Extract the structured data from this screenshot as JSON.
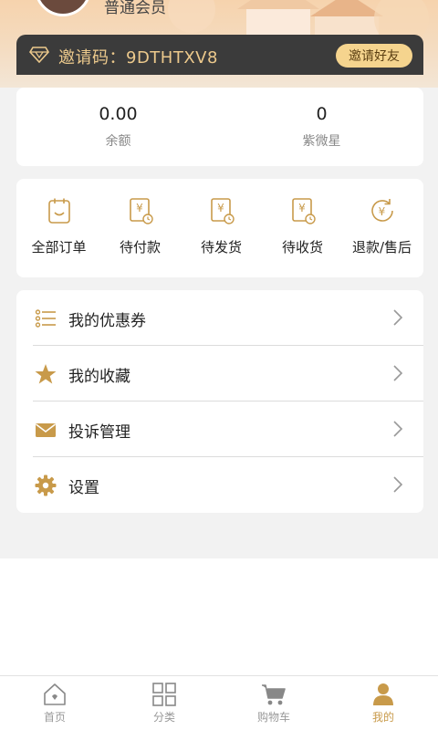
{
  "header": {
    "member_level": "普通会员",
    "invite_code_text": "邀请码：9DTHTXV8",
    "invite_button": "邀请好友"
  },
  "stats": [
    {
      "value": "0.00",
      "label": "余额"
    },
    {
      "value": "0",
      "label": "紫微星"
    }
  ],
  "orders": [
    {
      "label": "全部订单",
      "icon": "order-list-icon"
    },
    {
      "label": "待付款",
      "icon": "pending-payment-icon"
    },
    {
      "label": "待发货",
      "icon": "pending-shipment-icon"
    },
    {
      "label": "待收货",
      "icon": "pending-receipt-icon"
    },
    {
      "label": "退款/售后",
      "icon": "refund-icon"
    }
  ],
  "menu": [
    {
      "label": "我的优惠券",
      "icon": "coupon-list-icon"
    },
    {
      "label": "我的收藏",
      "icon": "star-icon"
    },
    {
      "label": "投诉管理",
      "icon": "envelope-icon"
    },
    {
      "label": "设置",
      "icon": "gear-icon"
    }
  ],
  "tabbar": [
    {
      "label": "首页",
      "icon": "home-icon",
      "active": false
    },
    {
      "label": "分类",
      "icon": "grid-icon",
      "active": false
    },
    {
      "label": "购物车",
      "icon": "cart-icon",
      "active": false
    },
    {
      "label": "我的",
      "icon": "person-icon",
      "active": true
    }
  ],
  "colors": {
    "accent": "#c89a4a",
    "invite_bar": "#3b3b3b",
    "invite_text": "#ecc98c",
    "invite_button_bg": "#f5d48e"
  }
}
